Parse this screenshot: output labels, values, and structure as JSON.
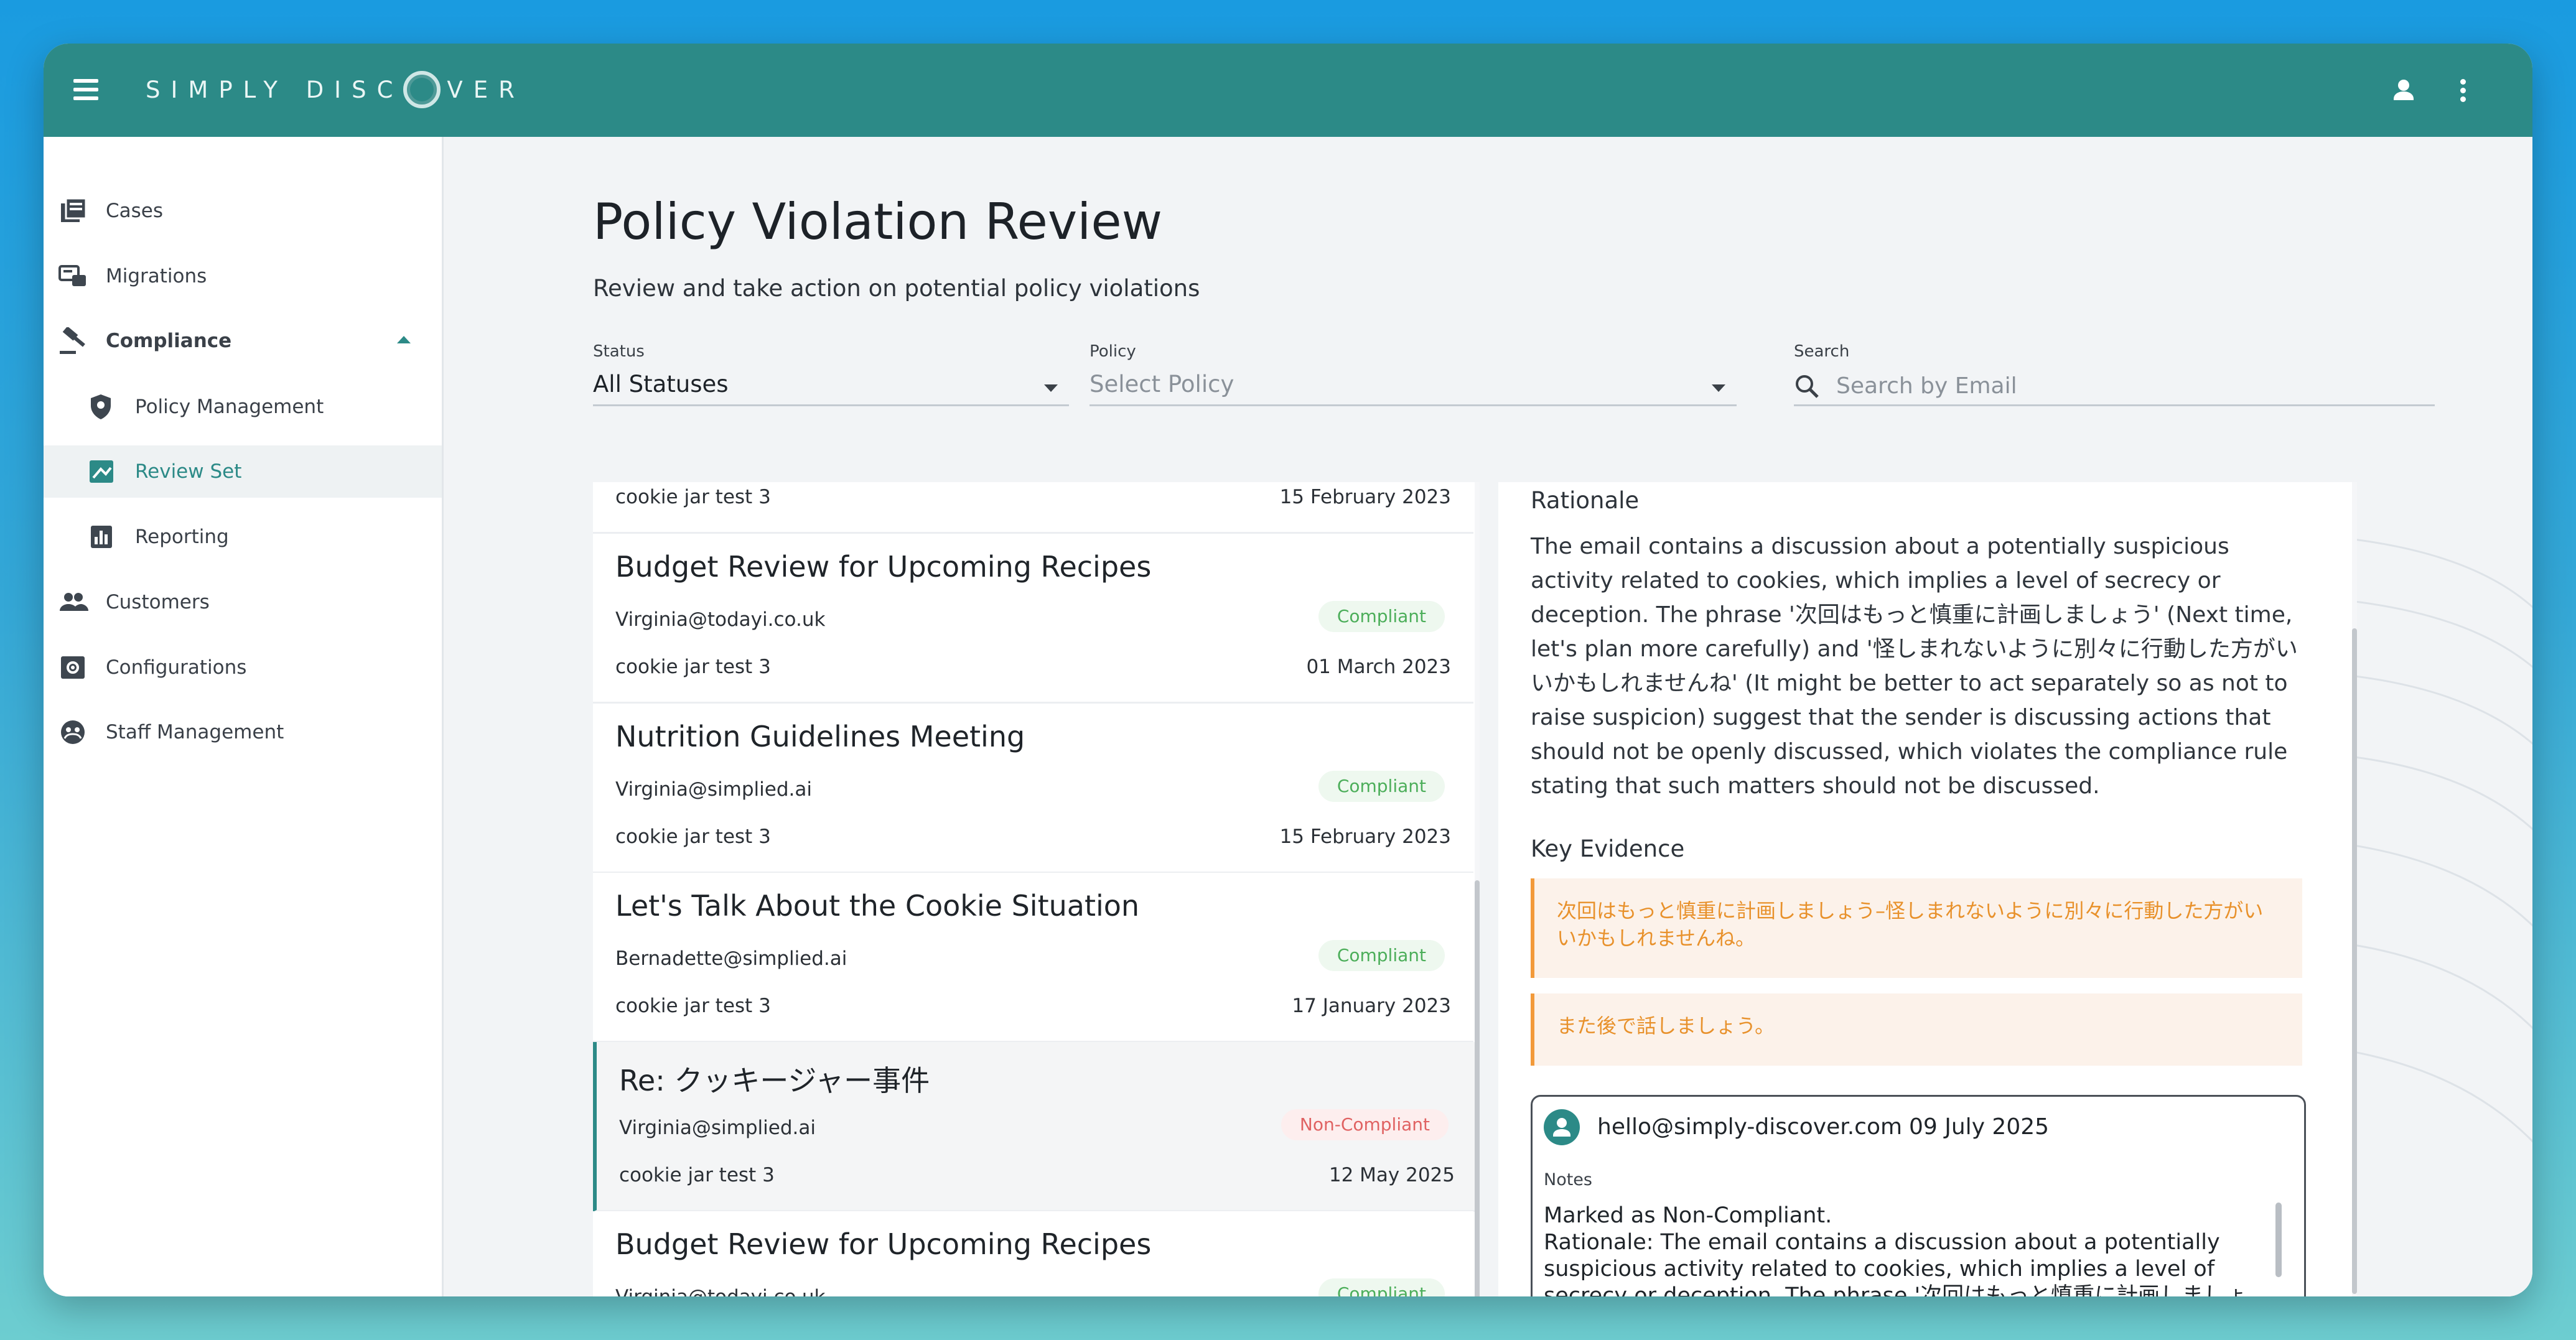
{
  "app": {
    "brand": "SIMPLY DISCOVER",
    "brand_parts": {
      "before": "SIMPLY DISC",
      "after": "VER"
    }
  },
  "sidebar": {
    "items": [
      {
        "label": "Cases",
        "icon": "cases-icon"
      },
      {
        "label": "Migrations",
        "icon": "migrations-icon"
      },
      {
        "label": "Compliance",
        "icon": "gavel-icon",
        "expanded": true
      },
      {
        "label": "Policy Management",
        "icon": "policy-shield-icon"
      },
      {
        "label": "Review Set",
        "icon": "review-set-icon",
        "active": true
      },
      {
        "label": "Reporting",
        "icon": "bar-chart-icon"
      },
      {
        "label": "Customers",
        "icon": "people-icon"
      },
      {
        "label": "Configurations",
        "icon": "settings-box-icon"
      },
      {
        "label": "Staff Management",
        "icon": "staff-icon"
      }
    ]
  },
  "page": {
    "title": "Policy Violation Review",
    "subtitle": "Review and take action on potential policy violations"
  },
  "filters": {
    "status": {
      "label": "Status",
      "value": "All Statuses"
    },
    "policy": {
      "label": "Policy",
      "placeholder": "Select Policy"
    },
    "search": {
      "label": "Search",
      "placeholder": "Search by Email"
    }
  },
  "emails": [
    {
      "title": "",
      "sender": "",
      "status": "",
      "case": "cookie jar test 3",
      "date": "15 February 2023"
    },
    {
      "title": "Budget Review for Upcoming Recipes",
      "sender": "Virginia@todayi.co.uk",
      "status": "Compliant",
      "case": "cookie jar test 3",
      "date": "01 March 2023"
    },
    {
      "title": "Nutrition Guidelines Meeting",
      "sender": "Virginia@simplied.ai",
      "status": "Compliant",
      "case": "cookie jar test 3",
      "date": "15 February 2023"
    },
    {
      "title": "Let's Talk About the Cookie Situation",
      "sender": "Bernadette@simplied.ai",
      "status": "Compliant",
      "case": "cookie jar test 3",
      "date": "17 January 2023"
    },
    {
      "title": "Re: クッキージャー事件",
      "sender": "Virginia@simplied.ai",
      "status": "Non-Compliant",
      "case": "cookie jar test 3",
      "date": "12 May 2025",
      "selected": true
    },
    {
      "title": "Budget Review for Upcoming Recipes",
      "sender": "Virginia@todayi.co.uk",
      "status": "Compliant",
      "case": "",
      "date": ""
    }
  ],
  "detail": {
    "rationale_heading": "Rationale",
    "rationale_text": "The email contains a discussion about a potentially suspicious activity related to cookies, which implies a level of secrecy or deception. The phrase '次回はもっと慎重に計画しましょう' (Next time, let's plan more carefully) and '怪しまれないように別々に行動した方がいいかもしれませんね' (It might be better to act separately so as not to raise suspicion) suggest that the sender is discussing actions that should not be openly discussed, which violates the compliance rule stating that such matters should not be discussed.",
    "evidence_heading": "Key Evidence",
    "evidence": [
      "次回はもっと慎重に計画しましょう–怪しまれないように別々に行動した方がいいかもしれませんね。",
      "また後で話しましょう。"
    ],
    "note": {
      "author": "hello@simply-discover.com",
      "date": "09 July 2025",
      "label": "Notes",
      "text": "Marked as Non-Compliant.\nRationale: The email contains a discussion about a potentially suspicious activity related to cookies, which implies a level of secrecy or deception. The phrase '次回はもっと慎重に計画しましょう' (Next time, let's plan more carefully) and '怪しまれないように別々に行動した方がいいかもしれませんね'"
    }
  },
  "colors": {
    "brand_teal": "#2c8a87",
    "compliant": "#4cae5a",
    "non_compliant": "#e06262",
    "evidence": "#e8912b"
  }
}
